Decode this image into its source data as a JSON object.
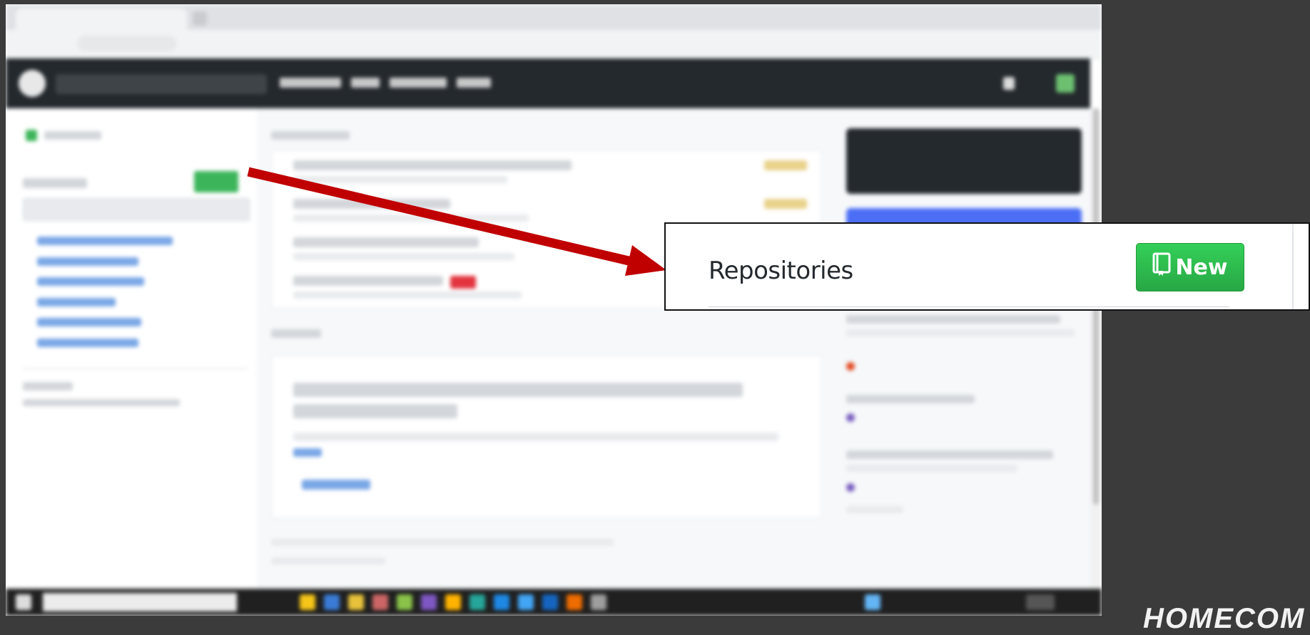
{
  "callout": {
    "title": "Repositories",
    "new_button_label": "New",
    "button_icon": "repo-book-icon"
  },
  "watermark": {
    "text": "HOMECOM"
  },
  "colors": {
    "background": "#3b3b3b",
    "arrow": "#c00000",
    "button_green": "#2ea44f",
    "header_dark": "#24292e"
  }
}
